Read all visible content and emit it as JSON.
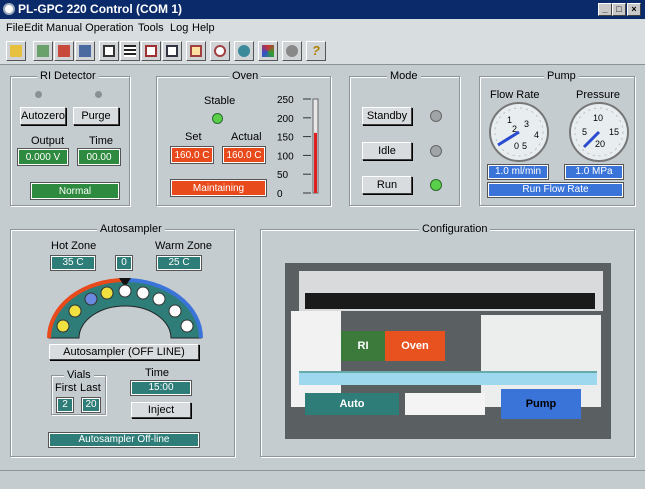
{
  "window": {
    "title": "PL-GPC 220 Control (COM 1)",
    "min": "_",
    "max": "□",
    "close": "×"
  },
  "menu": [
    "File",
    "Edit",
    "Manual Operation",
    "Tools",
    "Log",
    "Help"
  ],
  "ri": {
    "title": "RI Detector",
    "autozero": "Autozero",
    "purge": "Purge",
    "output_label": "Output",
    "time_label": "Time",
    "output": "0.000 V",
    "time": "00.00",
    "status": "Normal"
  },
  "oven": {
    "title": "Oven",
    "stable_label": "Stable",
    "set_label": "Set",
    "actual_label": "Actual",
    "set": "160.0 C",
    "actual": "160.0 C",
    "status": "Maintaining",
    "ticks": [
      "250",
      "200",
      "150",
      "100",
      "50",
      "0"
    ],
    "level": 0.64
  },
  "mode": {
    "title": "Mode",
    "standby": "Standby",
    "idle": "Idle",
    "run": "Run",
    "active": "Run"
  },
  "pump": {
    "title": "Pump",
    "flow_label": "Flow Rate",
    "pressure_label": "Pressure",
    "flow": "1.0 ml/min",
    "pressure": "1.0 MPa",
    "status": "Run Flow Rate",
    "flow_ticks": [
      "1",
      "2",
      "3",
      "4",
      "5",
      "0"
    ],
    "pressure_ticks": [
      "5",
      "10",
      "15",
      "20"
    ]
  },
  "autosampler": {
    "title": "Autosampler",
    "hot_label": "Hot Zone",
    "warm_label": "Warm Zone",
    "hot": "35 C",
    "middle": "0",
    "warm": "25 C",
    "button": "Autosampler (OFF LINE)",
    "vials_label": "Vials",
    "first_label": "First",
    "last_label": "Last",
    "first": "2",
    "last": "20",
    "time_label": "Time",
    "time": "15:00",
    "inject": "Inject",
    "status": "Autosampler Off-line"
  },
  "config": {
    "title": "Configuration",
    "ri": "RI",
    "oven": "Oven",
    "auto": "Auto",
    "pump": "Pump"
  },
  "colors": {
    "accent_green": "#2e8a3e",
    "alert_red": "#e84a1c",
    "teal": "#2e7d78",
    "blue": "#3a74d8"
  }
}
